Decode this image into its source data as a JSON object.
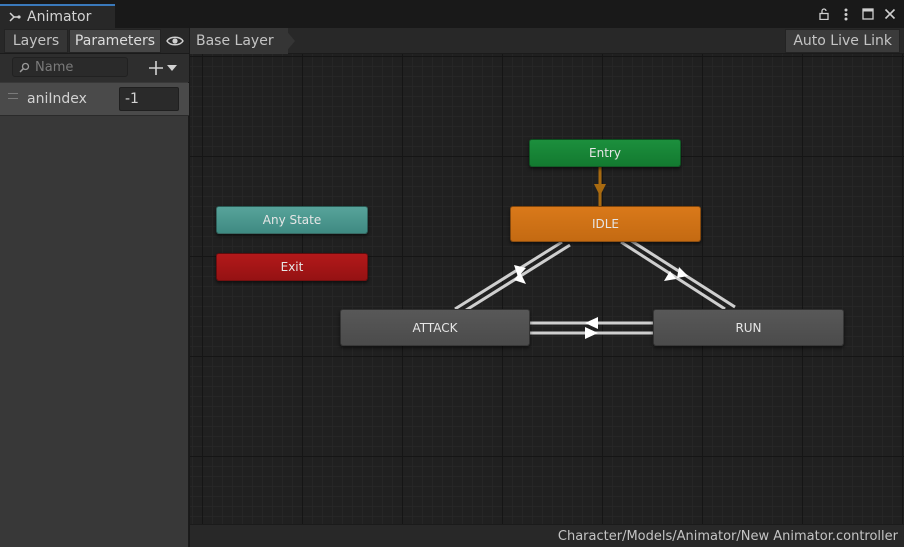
{
  "window": {
    "title": "Animator",
    "controls": [
      "lock-icon",
      "kebab-menu-icon",
      "maximize-icon",
      "close-icon"
    ]
  },
  "toolbar": {
    "layers_label": "Layers",
    "parameters_label": "Parameters",
    "breadcrumb": "Base Layer",
    "auto_live_link_label": "Auto Live Link"
  },
  "parameters": {
    "search_placeholder": "Name",
    "items": [
      {
        "name": "aniIndex",
        "value": "-1"
      }
    ]
  },
  "graph": {
    "states": {
      "entry": "Entry",
      "any_state": "Any State",
      "exit": "Exit",
      "idle": "IDLE",
      "attack": "ATTACK",
      "run": "RUN"
    }
  },
  "status": {
    "controller_path": "Character/Models/Animator/New Animator.controller"
  },
  "colors": {
    "entry": "#1c8f3d",
    "any_state": "#57a39a",
    "exit": "#b3191a",
    "default_state": "#d9791a",
    "state": "#585858",
    "tab_accent": "#3a79bb"
  }
}
